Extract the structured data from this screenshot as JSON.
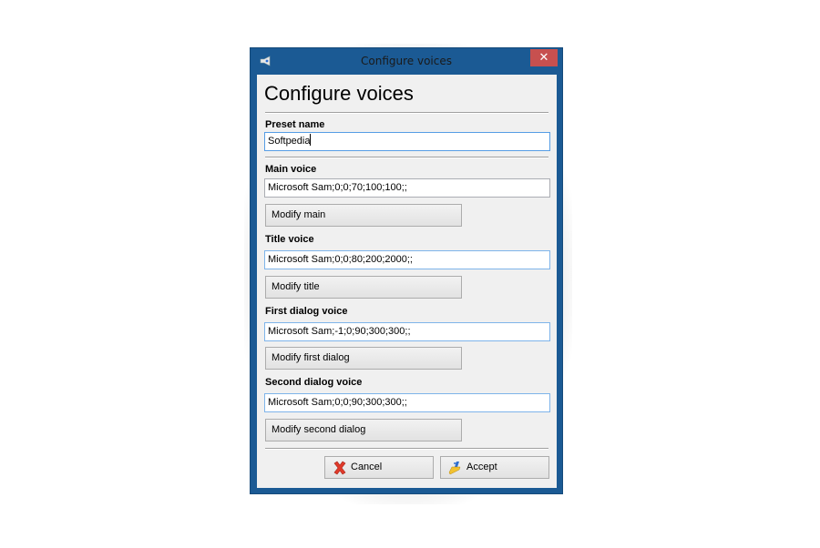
{
  "window": {
    "title": "Configure voices",
    "close_label": "✕"
  },
  "dialog": {
    "heading": "Configure voices",
    "preset": {
      "label": "Preset name",
      "value": "Softpedia"
    },
    "voices": [
      {
        "label": "Main voice",
        "value": "Microsoft Sam;0;0;70;100;100;;",
        "button": "Modify main"
      },
      {
        "label": "Title voice",
        "value": "Microsoft Sam;0;0;80;200;2000;;",
        "button": "Modify title"
      },
      {
        "label": "First dialog  voice",
        "value": "Microsoft Sam;-1;0;90;300;300;;",
        "button": "Modify first dialog"
      },
      {
        "label": "Second dialog voice",
        "value": "Microsoft Sam;0;0;90;300;300;;",
        "button": "Modify second dialog"
      }
    ],
    "footer": {
      "cancel_label": "Cancel",
      "cancel_icon": "red-x-icon",
      "accept_label": "Accept",
      "accept_icon": "broom-icon"
    }
  },
  "colors": {
    "titlebar": "#1b5a94",
    "close": "#c7504f",
    "client": "#f0f0f0",
    "focus_border": "#7eb4ea"
  }
}
